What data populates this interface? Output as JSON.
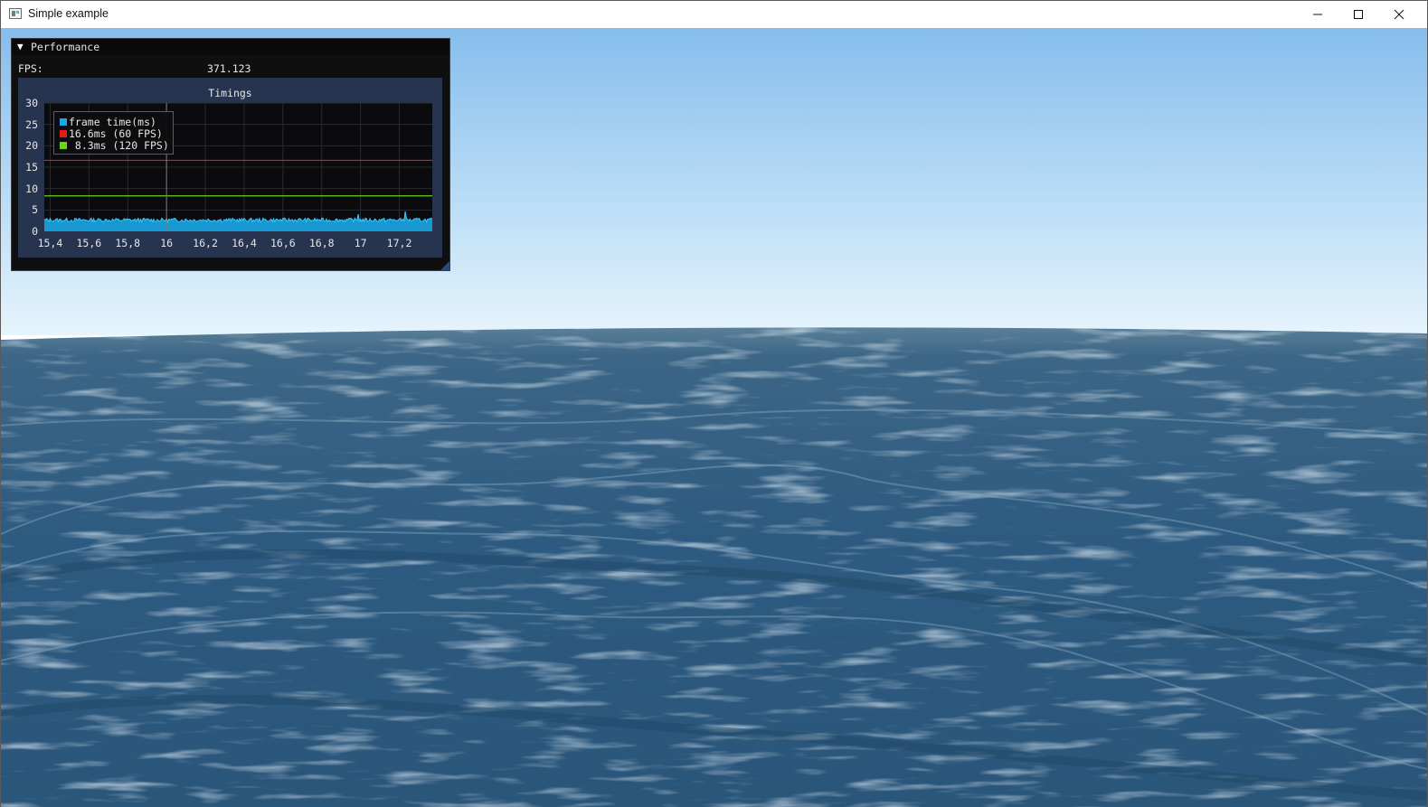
{
  "window": {
    "title": "Simple example",
    "icon": "app-window-icon",
    "controls": [
      "minimize-icon",
      "maximize-icon",
      "close-icon"
    ]
  },
  "performance_panel": {
    "title": "Performance",
    "collapse_icon": "triangle-down-icon",
    "fps_label": "FPS:",
    "fps_value": "371.123"
  },
  "chart_data": {
    "type": "line",
    "title": "Timings",
    "xlabel": "",
    "ylabel": "",
    "x_ticks": [
      "15,4",
      "15,6",
      "15,8",
      "16",
      "16,2",
      "16,4",
      "16,6",
      "16,8",
      "17",
      "17,2"
    ],
    "y_ticks": [
      "30",
      "25",
      "20",
      "15",
      "10",
      "5",
      "0"
    ],
    "xlim": [
      15.37,
      17.37
    ],
    "ylim": [
      0,
      30
    ],
    "grid": true,
    "legend_position": "top-left",
    "series": [
      {
        "name": "frame time(ms)",
        "color": "#1aa7e6",
        "kind": "shaded",
        "approx_value": 2.6,
        "range": [
          2.2,
          3.1
        ],
        "spikes": [
          {
            "x": 16.99,
            "y": 4.0
          },
          {
            "x": 17.23,
            "y": 4.7
          }
        ]
      },
      {
        "name": "16.6ms (60 FPS)",
        "color": "#e31a1a",
        "kind": "hline",
        "value": 16.6
      },
      {
        "name": " 8.3ms (120 FPS)",
        "color": "#6ad41a",
        "kind": "hline",
        "value": 8.3
      }
    ],
    "cursor_x": 16.0
  },
  "colors": {
    "sky_top": "#8dc0ec",
    "sky_horizon": "#e2f1fb",
    "ocean": "#2f5c80",
    "panel_bg": "#0f0f0f",
    "plot_frame": "#263450"
  }
}
